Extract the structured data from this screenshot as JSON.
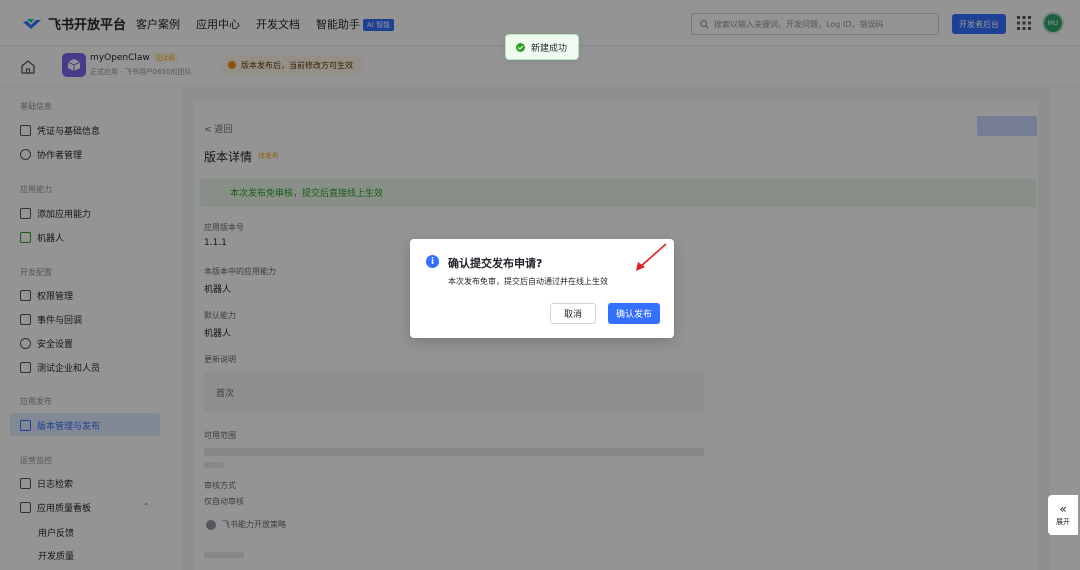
{
  "nav": {
    "brand": "飞书开放平台",
    "links": [
      "客户案例",
      "应用中心",
      "开发文档",
      "智能助手"
    ],
    "assistant_badge": "AI 智能",
    "search_placeholder": "搜索以输入关键词，开发问题，Log ID，错误码",
    "console_button": "开发者后台",
    "avatar_initials": "HU"
  },
  "app": {
    "name": "myOpenClaw",
    "status": "已上线",
    "subtitle": "正式应用 · 飞书用户0650的团队",
    "notice": "版本发布后，当前修改方可生效"
  },
  "toast": {
    "message": "新建成功"
  },
  "sidebar": {
    "groups": {
      "basic": "基础信息",
      "capability": "应用能力",
      "dev_config": "开发配置",
      "publish": "应用发布",
      "ops": "运营监控"
    },
    "items": {
      "credentials": "凭证与基础信息",
      "collaborators": "协作者管理",
      "add_capability": "添加应用能力",
      "bot": "机器人",
      "permissions": "权限管理",
      "events": "事件与回调",
      "security": "安全设置",
      "test_users": "测试企业和人员",
      "versions": "版本管理与发布",
      "logs": "日志检索",
      "quality": "应用质量看板",
      "feedback": "用户反馈",
      "dev_quality": "开发质量"
    }
  },
  "main": {
    "back": "< 返回",
    "title": "版本详情",
    "title_tag": "待发布",
    "status_bar": "本次发布免审核，提交后直接线上生效",
    "version_label": "应用版本号",
    "version_value": "1.1.1",
    "capability_label": "本版本中的应用能力",
    "capability_value": "机器人",
    "default_label": "默认能力",
    "default_value": "机器人",
    "notes_label": "更新说明",
    "notes_value": "首次",
    "range_label": "可用范围",
    "footer_label": "审核方式",
    "footer_value": "仅自动审核",
    "unsaved": "飞书能力开放策略"
  },
  "dialog": {
    "title": "确认提交发布申请?",
    "description": "本次发布免审，提交后自动通过并在线上生效",
    "cancel": "取消",
    "confirm": "确认发布",
    "info_icon": "i"
  },
  "expand_tab": {
    "label": "展开",
    "icon": "«"
  },
  "colors": {
    "primary": "#3370ff",
    "success": "#2ea121",
    "warning": "#f28c18",
    "annotation_arrow": "#e02020"
  }
}
